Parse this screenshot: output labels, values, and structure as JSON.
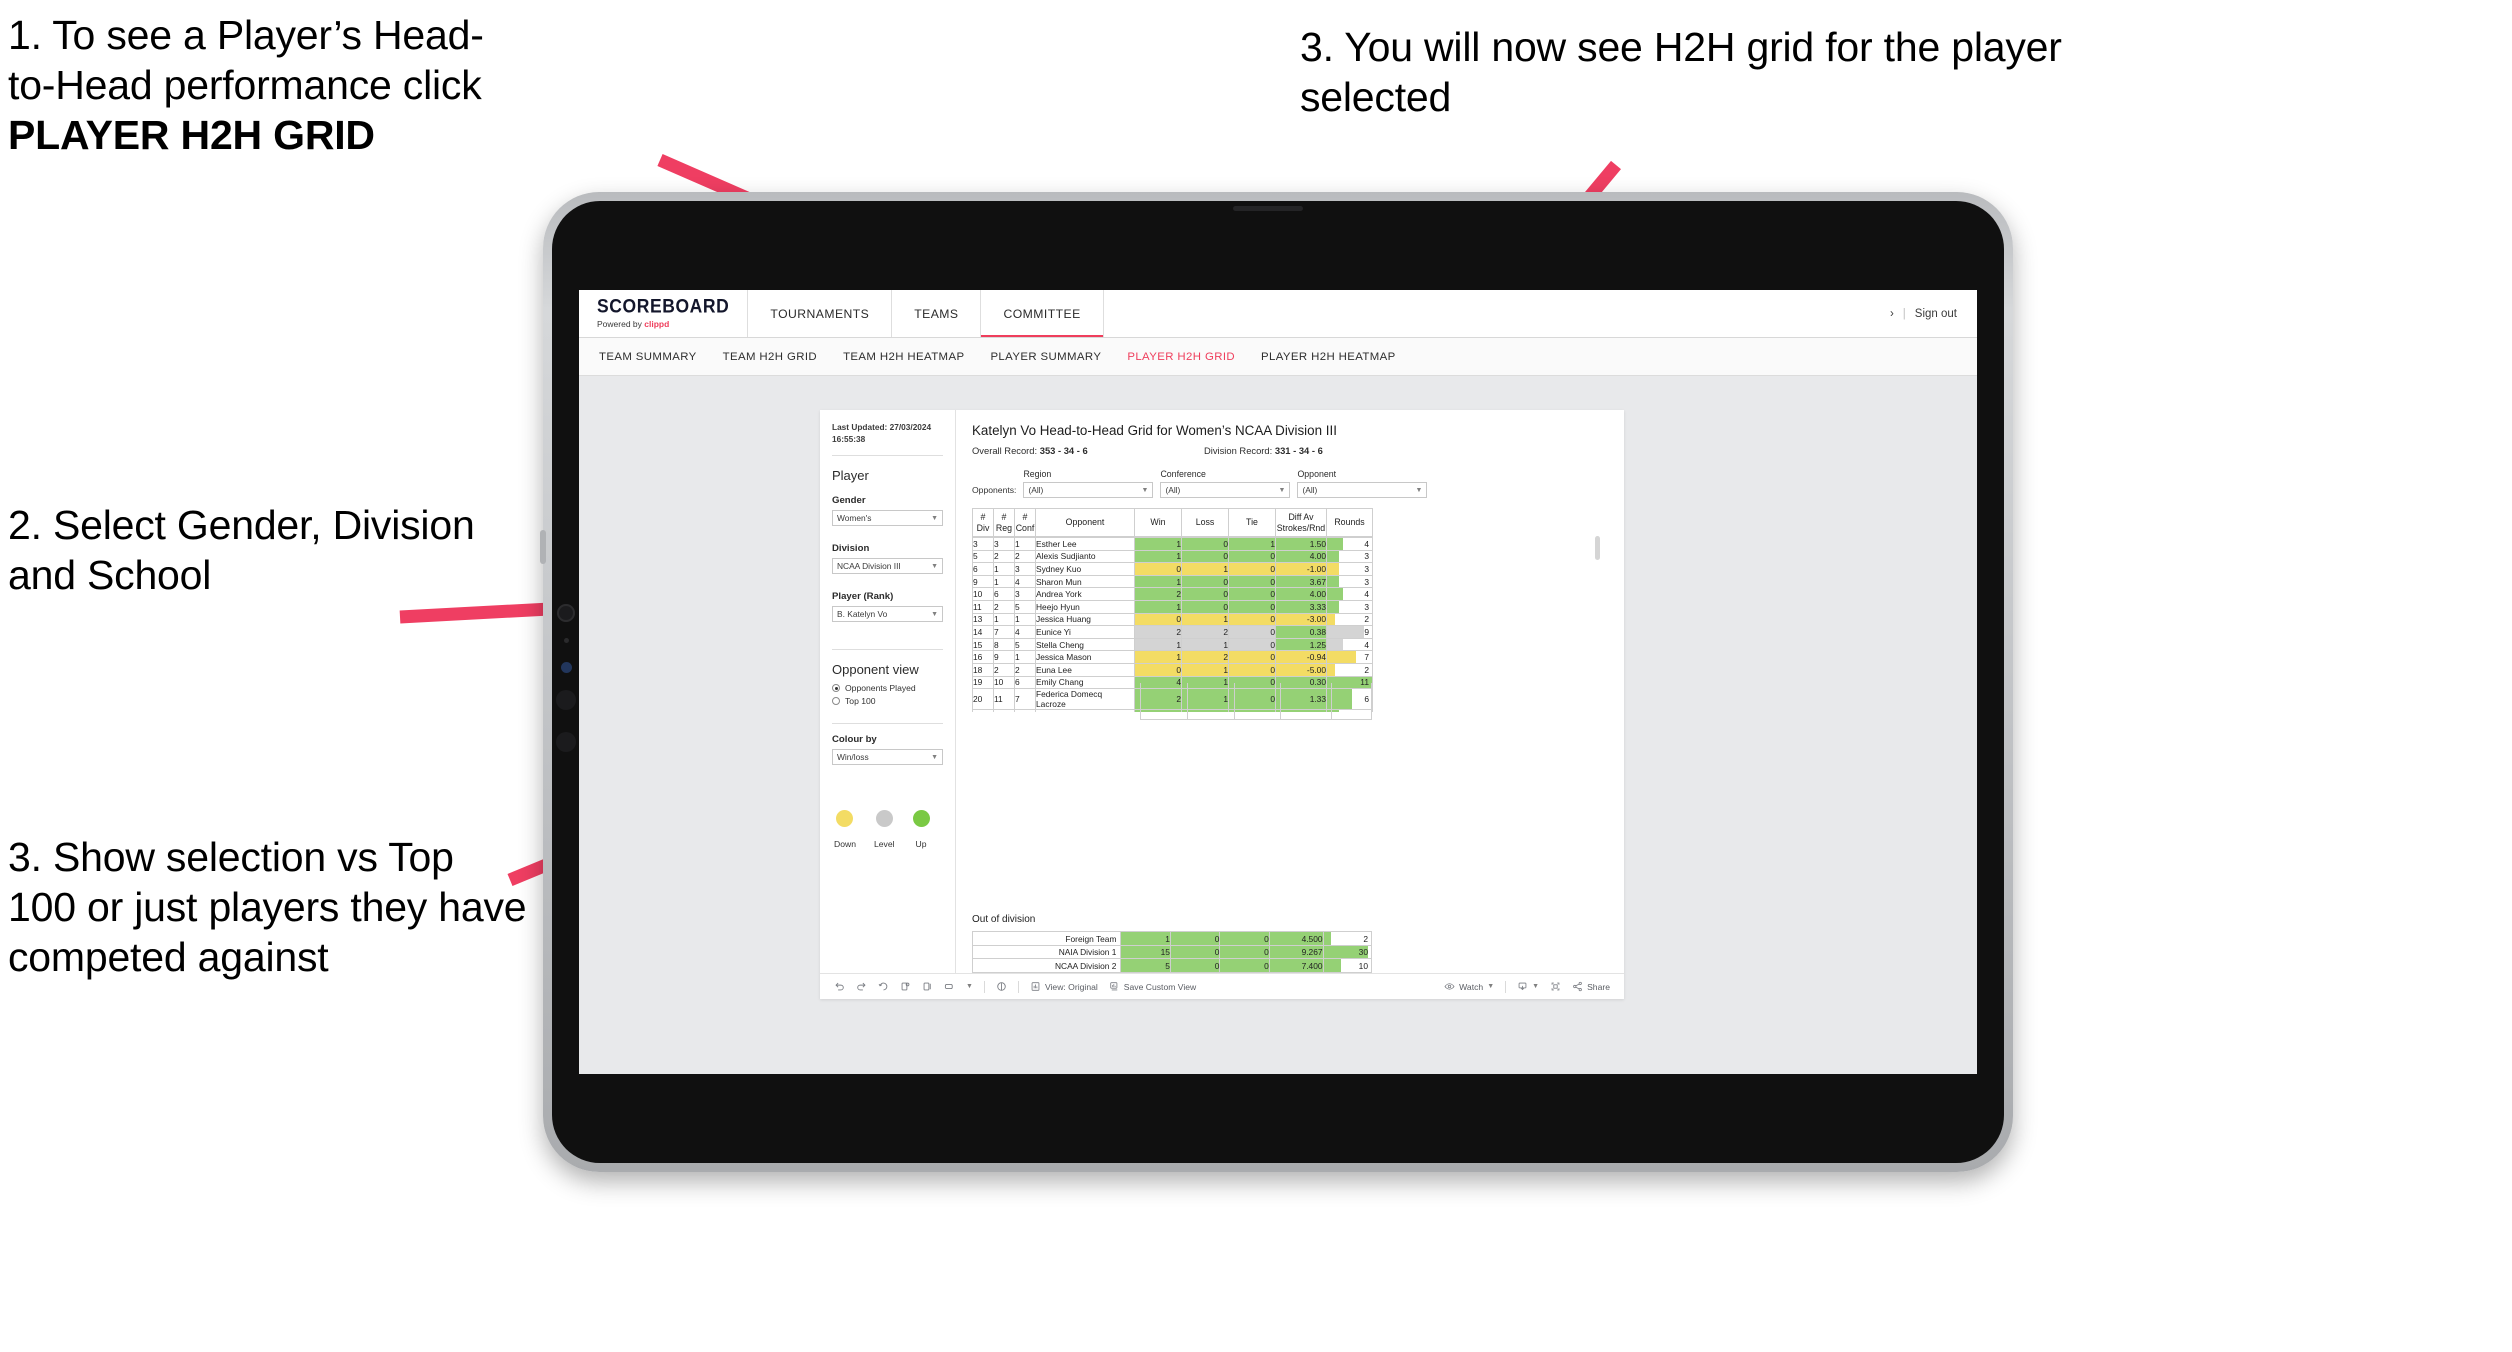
{
  "annotations": [
    {
      "id": "a1",
      "line1": "1. To see a Player’s Head-",
      "line2": "to-Head performance click",
      "bold": "PLAYER H2H GRID"
    },
    {
      "id": "a2",
      "text": "2. Select Gender, Division and School"
    },
    {
      "id": "a3",
      "text": "3. Show selection vs Top 100 or just players they have competed against"
    },
    {
      "id": "a4",
      "text": "3. You will now see H2H grid for the player selected"
    }
  ],
  "app": {
    "brand_name": "SCOREBOARD",
    "brand_sub_prefix": "Powered by ",
    "brand_sub_name": "clippd",
    "top_nav": [
      "TOURNAMENTS",
      "TEAMS",
      "COMMITTEE"
    ],
    "header_right": {
      "chevron": "›",
      "separator": "|",
      "sign_out": "Sign out"
    },
    "sub_nav": [
      {
        "label": "TEAM SUMMARY",
        "active": false
      },
      {
        "label": "TEAM H2H GRID",
        "active": false
      },
      {
        "label": "TEAM H2H HEATMAP",
        "active": false
      },
      {
        "label": "PLAYER SUMMARY",
        "active": false
      },
      {
        "label": "PLAYER H2H GRID",
        "active": true
      },
      {
        "label": "PLAYER H2H HEATMAP",
        "active": false
      }
    ],
    "accent_color": "#ef3e5c"
  },
  "filters": {
    "last_updated_line1": "Last Updated: 27/03/2024",
    "last_updated_line2": "16:55:38",
    "player_heading": "Player",
    "gender": {
      "label": "Gender",
      "value": "Women's"
    },
    "division": {
      "label": "Division",
      "value": "NCAA Division III"
    },
    "player_rank": {
      "label": "Player (Rank)",
      "value": "B. Katelyn Vo"
    },
    "opponent_view": {
      "heading": "Opponent view",
      "options": [
        {
          "label": "Opponents Played",
          "selected": true
        },
        {
          "label": "Top 100",
          "selected": false
        }
      ]
    },
    "colour_by": {
      "label": "Colour by",
      "value": "Win/loss"
    },
    "legend": [
      {
        "caption": "Down",
        "color": "#f3dc64"
      },
      {
        "caption": "Level",
        "color": "#c9c9c9"
      },
      {
        "caption": "Up",
        "color": "#7ac943"
      }
    ]
  },
  "viz": {
    "title": "Katelyn Vo Head-to-Head Grid for Women’s NCAA Division III",
    "overall_record_label": "Overall Record: ",
    "overall_record_value": "353 -  34 - 6",
    "division_record_label": "Division Record: ",
    "division_record_value": "331 -  34 - 6",
    "opponents_label": "Opponents:",
    "opponent_filters": [
      {
        "label": "Region",
        "value": "(All)"
      },
      {
        "label": "Conference",
        "value": "(All)"
      },
      {
        "label": "Opponent",
        "value": "(All)"
      }
    ],
    "columns": [
      "# Div",
      "# Reg",
      "# Conf",
      "Opponent",
      "Win",
      "Loss",
      "Tie",
      "Diff Av Strokes/Rnd",
      "Rounds"
    ],
    "column_headers_split": [
      {
        "top": "#",
        "bottom": "Div"
      },
      {
        "top": "#",
        "bottom": "Reg"
      },
      {
        "top": "#",
        "bottom": "Conf"
      },
      {
        "top": "",
        "bottom": "Opponent"
      },
      {
        "top": "",
        "bottom": "Win"
      },
      {
        "top": "",
        "bottom": "Loss"
      },
      {
        "top": "",
        "bottom": "Tie"
      },
      {
        "top": "Diff Av",
        "bottom": "Strokes/Rnd"
      },
      {
        "top": "",
        "bottom": "Rounds"
      }
    ],
    "rows": [
      {
        "div": "3",
        "reg": "3",
        "conf": "1",
        "opponent": "Esther Lee",
        "win": "1",
        "loss": "0",
        "tie": "1",
        "diff": "1.50",
        "rounds": "4",
        "state": "up",
        "rounds_pct": 36
      },
      {
        "div": "5",
        "reg": "2",
        "conf": "2",
        "opponent": "Alexis Sudjianto",
        "win": "1",
        "loss": "0",
        "tie": "0",
        "diff": "4.00",
        "rounds": "3",
        "state": "up",
        "rounds_pct": 27
      },
      {
        "div": "6",
        "reg": "1",
        "conf": "3",
        "opponent": "Sydney Kuo",
        "win": "0",
        "loss": "1",
        "tie": "0",
        "diff": "-1.00",
        "rounds": "3",
        "state": "down",
        "rounds_pct": 27
      },
      {
        "div": "9",
        "reg": "1",
        "conf": "4",
        "opponent": "Sharon Mun",
        "win": "1",
        "loss": "0",
        "tie": "0",
        "diff": "3.67",
        "rounds": "3",
        "state": "up",
        "rounds_pct": 27
      },
      {
        "div": "10",
        "reg": "6",
        "conf": "3",
        "opponent": "Andrea York",
        "win": "2",
        "loss": "0",
        "tie": "0",
        "diff": "4.00",
        "rounds": "4",
        "state": "up",
        "rounds_pct": 36
      },
      {
        "div": "11",
        "reg": "2",
        "conf": "5",
        "opponent": "Heejo Hyun",
        "win": "1",
        "loss": "0",
        "tie": "0",
        "diff": "3.33",
        "rounds": "3",
        "state": "up",
        "rounds_pct": 27
      },
      {
        "div": "13",
        "reg": "1",
        "conf": "1",
        "opponent": "Jessica Huang",
        "win": "0",
        "loss": "1",
        "tie": "0",
        "diff": "-3.00",
        "rounds": "2",
        "state": "down",
        "rounds_pct": 18
      },
      {
        "div": "14",
        "reg": "7",
        "conf": "4",
        "opponent": "Eunice Yi",
        "win": "2",
        "loss": "2",
        "tie": "0",
        "diff": "0.38",
        "rounds": "9",
        "state": "level",
        "rounds_pct": 82,
        "diff_state": "up"
      },
      {
        "div": "15",
        "reg": "8",
        "conf": "5",
        "opponent": "Stella Cheng",
        "win": "1",
        "loss": "1",
        "tie": "0",
        "diff": "1.25",
        "rounds": "4",
        "state": "level",
        "rounds_pct": 36,
        "diff_state": "up"
      },
      {
        "div": "16",
        "reg": "9",
        "conf": "1",
        "opponent": "Jessica Mason",
        "win": "1",
        "loss": "2",
        "tie": "0",
        "diff": "-0.94",
        "rounds": "7",
        "state": "down",
        "rounds_pct": 64
      },
      {
        "div": "18",
        "reg": "2",
        "conf": "2",
        "opponent": "Euna Lee",
        "win": "0",
        "loss": "1",
        "tie": "0",
        "diff": "-5.00",
        "rounds": "2",
        "state": "down",
        "rounds_pct": 18
      },
      {
        "div": "19",
        "reg": "10",
        "conf": "6",
        "opponent": "Emily Chang",
        "win": "4",
        "loss": "1",
        "tie": "0",
        "diff": "0.30",
        "rounds": "11",
        "state": "up",
        "rounds_pct": 100
      },
      {
        "div": "20",
        "reg": "11",
        "conf": "7",
        "opponent": "Federica Domecq Lacroze",
        "win": "2",
        "loss": "1",
        "tie": "0",
        "diff": "1.33",
        "rounds": "6",
        "state": "up",
        "rounds_pct": 55
      }
    ],
    "out_of_division": {
      "title": "Out of division",
      "rows": [
        {
          "name": "Foreign Team",
          "win": "1",
          "loss": "0",
          "tie": "0",
          "diff": "4.500",
          "rounds": "2",
          "state": "up",
          "rounds_pct": 16
        },
        {
          "name": "NAIA Division 1",
          "win": "15",
          "loss": "0",
          "tie": "0",
          "diff": "9.267",
          "rounds": "30",
          "state": "up",
          "rounds_pct": 94
        },
        {
          "name": "NCAA Division 2",
          "win": "5",
          "loss": "0",
          "tie": "0",
          "diff": "7.400",
          "rounds": "10",
          "state": "up",
          "rounds_pct": 36
        }
      ]
    },
    "colors": {
      "up": "#95d175",
      "down": "#f3dc64",
      "level": "#d4d4d4"
    }
  },
  "toolbar": {
    "undo": "undo-icon",
    "redo": "redo-icon",
    "revert": "revert-icon",
    "refresh": "refresh-data-icon",
    "pause": "pause-icon",
    "view_shape": "view-shape-icon",
    "help": "help-icon",
    "view_original": "View: Original",
    "save_custom_view": "Save Custom View",
    "watch": "Watch",
    "download": "download-icon",
    "fullscreen": "fullscreen-icon",
    "share": "Share"
  }
}
